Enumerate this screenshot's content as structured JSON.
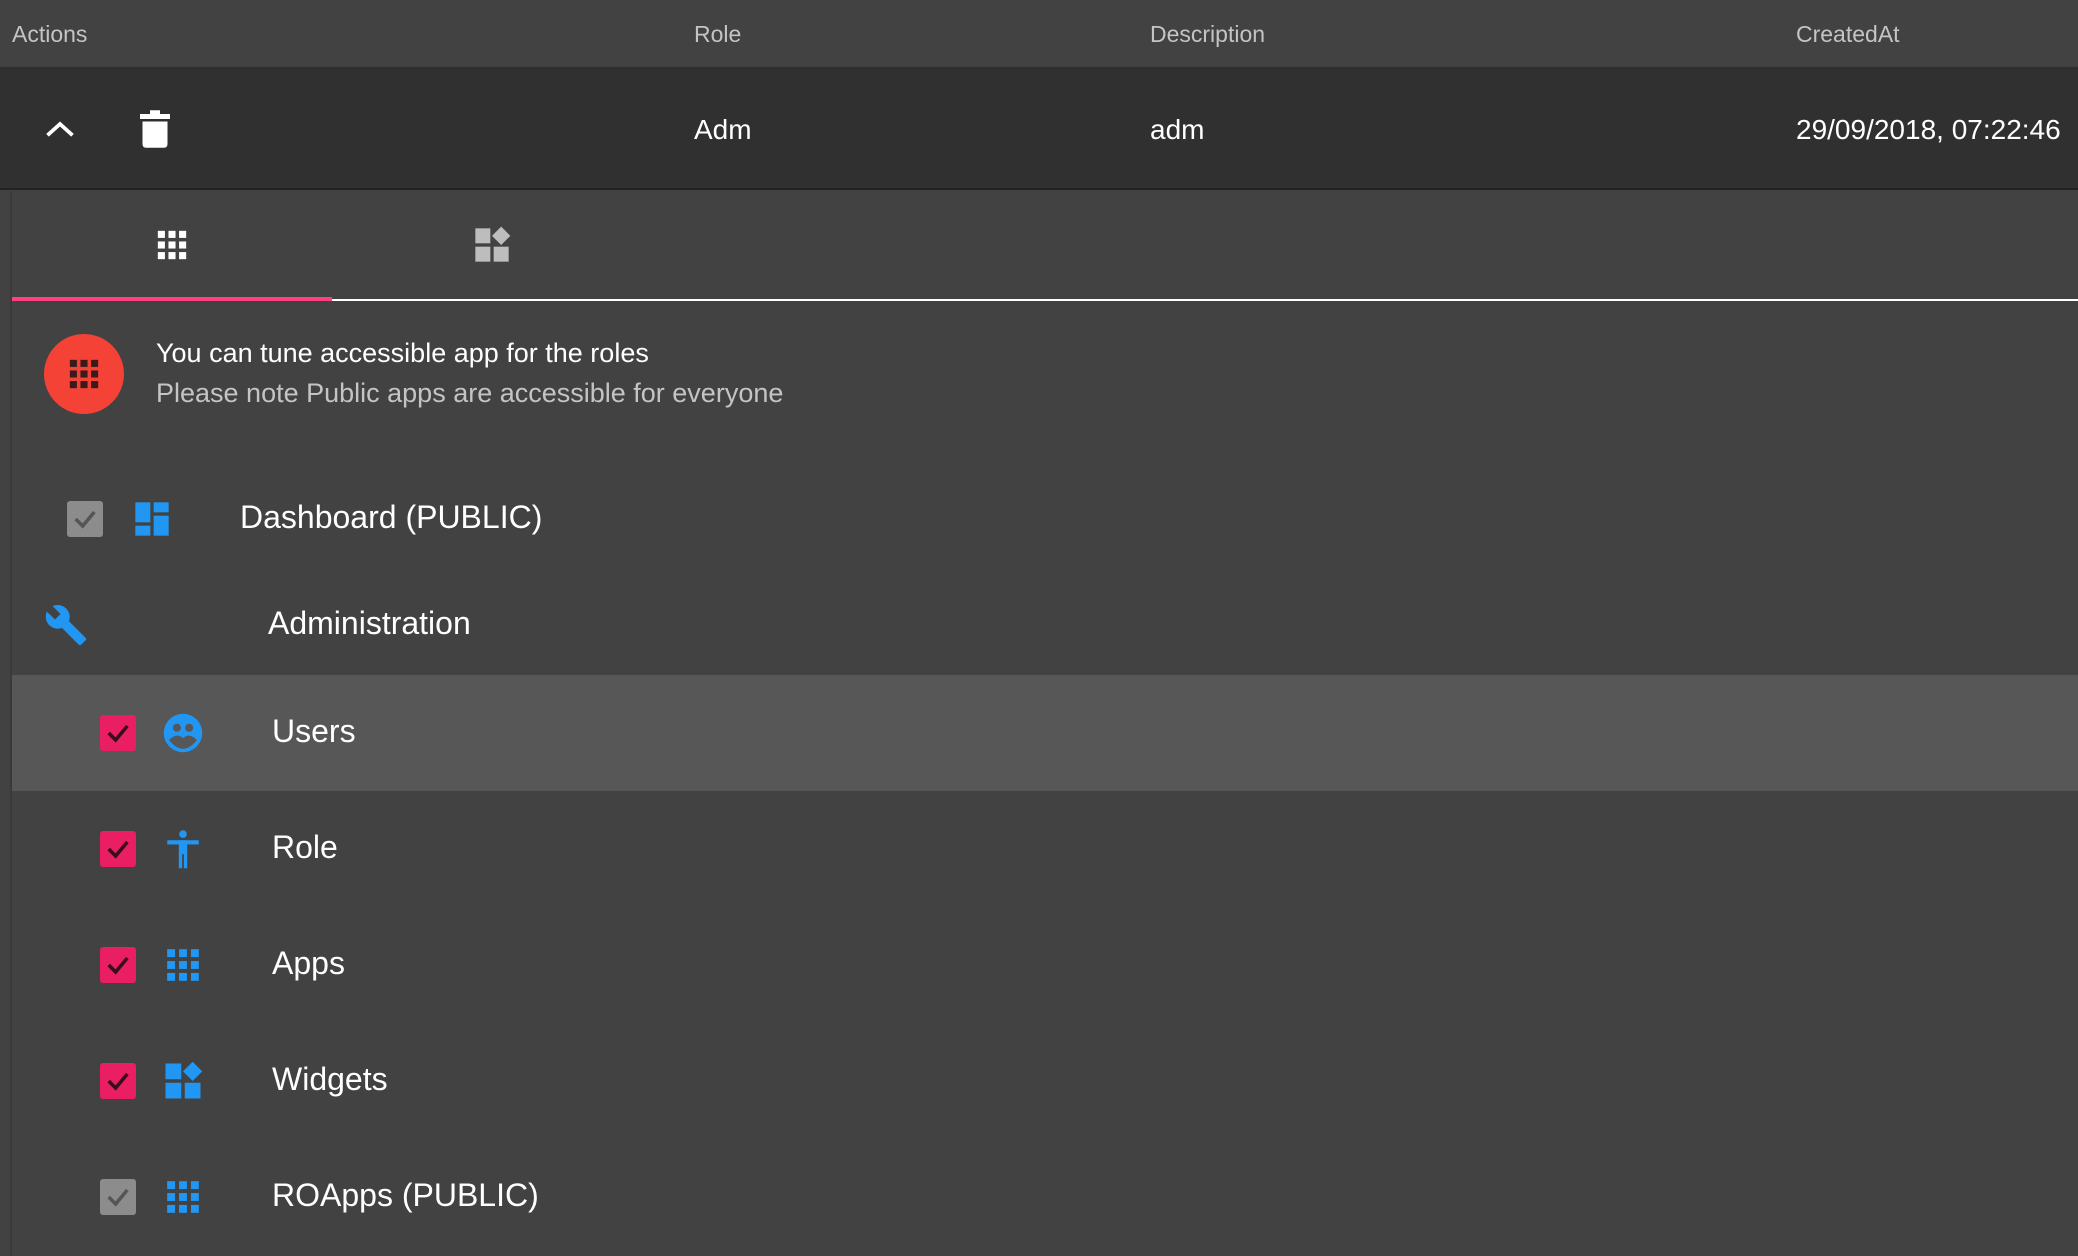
{
  "table": {
    "headers": {
      "actions": "Actions",
      "role": "Role",
      "description": "Description",
      "created_at": "CreatedAt"
    },
    "row": {
      "role": "Adm",
      "description": "adm",
      "created_at": "29/09/2018, 07:22:46",
      "expand_icon": "chevron-up-icon",
      "delete_icon": "trash-icon"
    }
  },
  "tabs": [
    {
      "icon": "apps-grid-icon",
      "active": true
    },
    {
      "icon": "widgets-icon",
      "active": false
    }
  ],
  "info": {
    "title": "You can tune accessible app for the roles",
    "subtitle": "Please note Public apps are accessible for everyone"
  },
  "apps": {
    "dashboard": {
      "label": "Dashboard (PUBLIC)",
      "checked": true,
      "public": true,
      "icon": "dashboard-icon"
    },
    "group": {
      "label": "Administration",
      "icon": "wrench-icon"
    },
    "items": [
      {
        "label": "Users",
        "checked": true,
        "icon": "supervised-user-icon"
      },
      {
        "label": "Role",
        "checked": true,
        "icon": "accessibility-icon"
      },
      {
        "label": "Apps",
        "checked": true,
        "icon": "apps-grid-icon"
      },
      {
        "label": "Widgets",
        "checked": true,
        "icon": "widgets-icon"
      },
      {
        "label": "ROApps (PUBLIC)",
        "checked": true,
        "public": true,
        "icon": "apps-grid-icon"
      }
    ]
  },
  "colors": {
    "background": "#424242",
    "row_background": "#303030",
    "accent_pink": "#e91e63",
    "tab_indicator": "#ff4081",
    "icon_blue": "#2196f3",
    "avatar_red": "#f44336",
    "public_check": "#8c8c8c"
  }
}
